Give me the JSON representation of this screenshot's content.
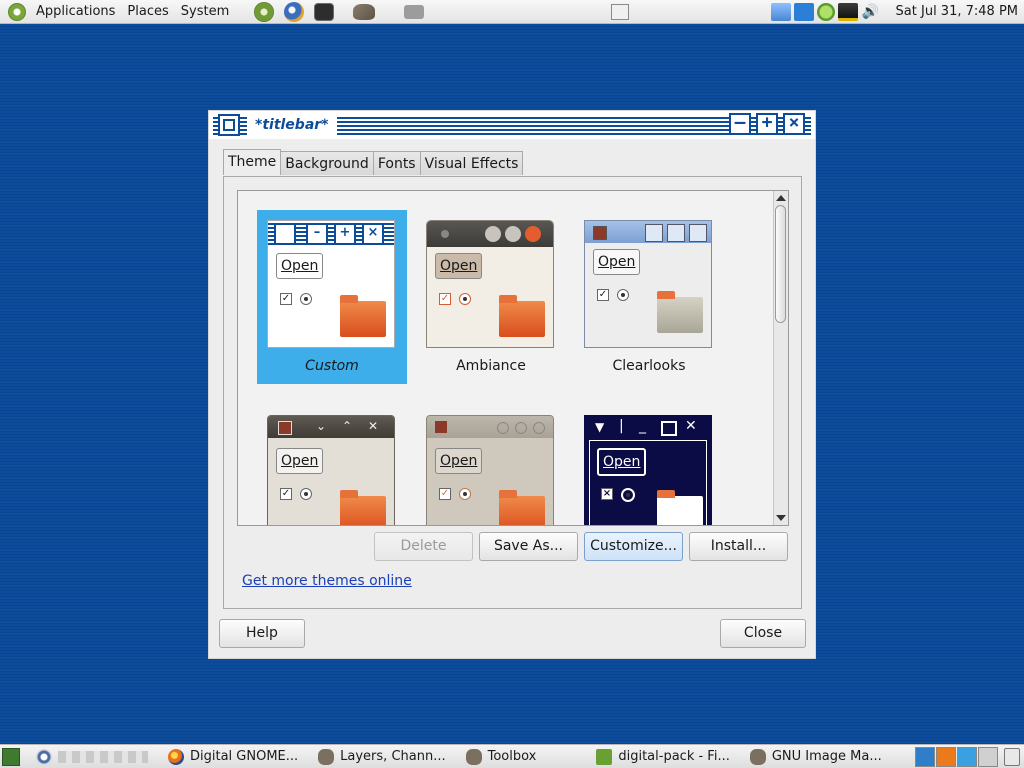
{
  "top_panel": {
    "menus": [
      "Applications",
      "Places",
      "System"
    ],
    "clock": "Sat Jul 31,  7:48 PM"
  },
  "dialog": {
    "title": "*titlebar*",
    "tabs": [
      {
        "label": "Theme",
        "active": true
      },
      {
        "label": "Background",
        "active": false
      },
      {
        "label": "Fonts",
        "active": false
      },
      {
        "label": "Visual Effects",
        "active": false
      }
    ],
    "themes": [
      {
        "name": "Custom",
        "selected": true,
        "open_label": "Open"
      },
      {
        "name": "Ambiance",
        "selected": false,
        "open_label": "Open"
      },
      {
        "name": "Clearlooks",
        "selected": false,
        "open_label": "Open"
      },
      {
        "name": "",
        "selected": false,
        "open_label": "Open"
      },
      {
        "name": "",
        "selected": false,
        "open_label": "Open"
      },
      {
        "name": "",
        "selected": false,
        "open_label": "Open"
      }
    ],
    "buttons": {
      "delete": "Delete",
      "save_as": "Save As...",
      "customize": "Customize...",
      "install": "Install..."
    },
    "link": "Get more themes online",
    "help": "Help",
    "close": "Close"
  },
  "bottom_panel": {
    "tasks": [
      "Digital GNOME...",
      "Layers, Chann...",
      "Toolbox",
      "digital-pack - Fi...",
      "GNU Image Ma..."
    ]
  },
  "colors": {
    "desktop": "#0d4c9a",
    "titlebar_accent": "#0d4c9a",
    "selection": "#3daee9",
    "link": "#1a3fb8"
  }
}
